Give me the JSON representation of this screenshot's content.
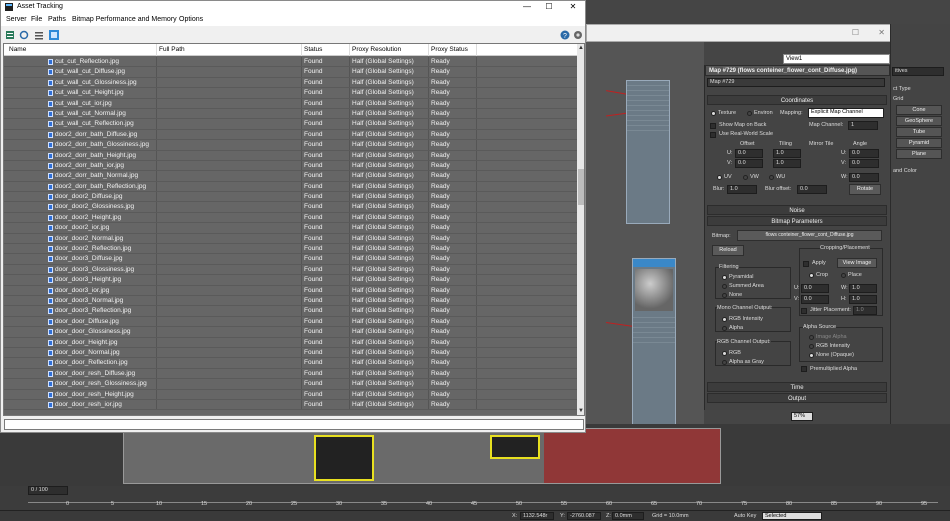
{
  "asset_window": {
    "title": "Asset Tracking",
    "controls": {
      "minimize": "—",
      "maximize": "☐",
      "close": "✕"
    },
    "menu": [
      "Server",
      "File",
      "Paths",
      "Bitmap Performance and Memory",
      "Options"
    ],
    "toolbar_icons": [
      "server-icon",
      "refresh-icon",
      "list-icon",
      "table-view-icon",
      "help-icon",
      "options-icon"
    ],
    "columns": [
      "Name",
      "Full Path",
      "Status",
      "Proxy Resolution",
      "Proxy Status"
    ],
    "rows": [
      {
        "name": "cut_cut_Reflection.jpg",
        "status": "Found",
        "proxy": "Half (Global Settings)",
        "pstat": "Ready"
      },
      {
        "name": "cut_wall_cut_Diffuse.jpg",
        "status": "Found",
        "proxy": "Half (Global Settings)",
        "pstat": "Ready"
      },
      {
        "name": "cut_wall_cut_Glossiness.jpg",
        "status": "Found",
        "proxy": "Half (Global Settings)",
        "pstat": "Ready"
      },
      {
        "name": "cut_wall_cut_Height.jpg",
        "status": "Found",
        "proxy": "Half (Global Settings)",
        "pstat": "Ready"
      },
      {
        "name": "cut_wall_cut_ior.jpg",
        "status": "Found",
        "proxy": "Half (Global Settings)",
        "pstat": "Ready"
      },
      {
        "name": "cut_wall_cut_Normal.jpg",
        "status": "Found",
        "proxy": "Half (Global Settings)",
        "pstat": "Ready"
      },
      {
        "name": "cut_wall_cut_Reflection.jpg",
        "status": "Found",
        "proxy": "Half (Global Settings)",
        "pstat": "Ready"
      },
      {
        "name": "door2_dorr_bath_Diffuse.jpg",
        "status": "Found",
        "proxy": "Half (Global Settings)",
        "pstat": "Ready"
      },
      {
        "name": "door2_dorr_bath_Glossiness.jpg",
        "status": "Found",
        "proxy": "Half (Global Settings)",
        "pstat": "Ready"
      },
      {
        "name": "door2_dorr_bath_Height.jpg",
        "status": "Found",
        "proxy": "Half (Global Settings)",
        "pstat": "Ready"
      },
      {
        "name": "door2_dorr_bath_ior.jpg",
        "status": "Found",
        "proxy": "Half (Global Settings)",
        "pstat": "Ready"
      },
      {
        "name": "door2_dorr_bath_Normal.jpg",
        "status": "Found",
        "proxy": "Half (Global Settings)",
        "pstat": "Ready"
      },
      {
        "name": "door2_dorr_bath_Reflection.jpg",
        "status": "Found",
        "proxy": "Half (Global Settings)",
        "pstat": "Ready"
      },
      {
        "name": "door_door2_Diffuse.jpg",
        "status": "Found",
        "proxy": "Half (Global Settings)",
        "pstat": "Ready"
      },
      {
        "name": "door_door2_Glossiness.jpg",
        "status": "Found",
        "proxy": "Half (Global Settings)",
        "pstat": "Ready"
      },
      {
        "name": "door_door2_Height.jpg",
        "status": "Found",
        "proxy": "Half (Global Settings)",
        "pstat": "Ready"
      },
      {
        "name": "door_door2_ior.jpg",
        "status": "Found",
        "proxy": "Half (Global Settings)",
        "pstat": "Ready"
      },
      {
        "name": "door_door2_Normal.jpg",
        "status": "Found",
        "proxy": "Half (Global Settings)",
        "pstat": "Ready"
      },
      {
        "name": "door_door2_Reflection.jpg",
        "status": "Found",
        "proxy": "Half (Global Settings)",
        "pstat": "Ready"
      },
      {
        "name": "door_door3_Diffuse.jpg",
        "status": "Found",
        "proxy": "Half (Global Settings)",
        "pstat": "Ready"
      },
      {
        "name": "door_door3_Glossiness.jpg",
        "status": "Found",
        "proxy": "Half (Global Settings)",
        "pstat": "Ready"
      },
      {
        "name": "door_door3_Height.jpg",
        "status": "Found",
        "proxy": "Half (Global Settings)",
        "pstat": "Ready"
      },
      {
        "name": "door_door3_ior.jpg",
        "status": "Found",
        "proxy": "Half (Global Settings)",
        "pstat": "Ready"
      },
      {
        "name": "door_door3_Normal.jpg",
        "status": "Found",
        "proxy": "Half (Global Settings)",
        "pstat": "Ready"
      },
      {
        "name": "door_door3_Reflection.jpg",
        "status": "Found",
        "proxy": "Half (Global Settings)",
        "pstat": "Ready"
      },
      {
        "name": "door_door_Diffuse.jpg",
        "status": "Found",
        "proxy": "Half (Global Settings)",
        "pstat": "Ready"
      },
      {
        "name": "door_door_Glossiness.jpg",
        "status": "Found",
        "proxy": "Half (Global Settings)",
        "pstat": "Ready"
      },
      {
        "name": "door_door_Height.jpg",
        "status": "Found",
        "proxy": "Half (Global Settings)",
        "pstat": "Ready"
      },
      {
        "name": "door_door_Normal.jpg",
        "status": "Found",
        "proxy": "Half (Global Settings)",
        "pstat": "Ready"
      },
      {
        "name": "door_door_Reflection.jpg",
        "status": "Found",
        "proxy": "Half (Global Settings)",
        "pstat": "Ready"
      },
      {
        "name": "door_door_resh_Diffuse.jpg",
        "status": "Found",
        "proxy": "Half (Global Settings)",
        "pstat": "Ready"
      },
      {
        "name": "door_door_resh_Glossiness.jpg",
        "status": "Found",
        "proxy": "Half (Global Settings)",
        "pstat": "Ready"
      },
      {
        "name": "door_door_resh_Height.jpg",
        "status": "Found",
        "proxy": "Half (Global Settings)",
        "pstat": "Ready"
      },
      {
        "name": "door_door_resh_ior.jpg",
        "status": "Found",
        "proxy": "Half (Global Settings)",
        "pstat": "Ready"
      }
    ],
    "path_value": ""
  },
  "material_editor": {
    "view_select": "View1",
    "map_title": "Map #729 (flows conteiner_flower_cont_Diffuse.jpg)",
    "map_name": "Map #729",
    "coordinates": {
      "header": "Coordinates",
      "texture": "Texture",
      "environ": "Environ",
      "mapping_label": "Mapping:",
      "mapping_value": "Explicit Map Channel",
      "show_map_on_back": "Show Map on Back",
      "map_channel_label": "Map Channel:",
      "map_channel_value": "1",
      "use_real_world": "Use Real-World Scale",
      "offset": "Offset",
      "tiling": "Tiling",
      "mirror_tile": "Mirror Tile",
      "angle": "Angle",
      "u_label": "U:",
      "v_label": "V:",
      "w_label": "W:",
      "u_offset": "0.0",
      "v_offset": "0.0",
      "u_tiling": "1.0",
      "v_tiling": "1.0",
      "u_angle": "0.0",
      "v_angle": "0.0",
      "w_angle": "0.0",
      "uv": "UV",
      "vw": "VW",
      "wu": "WU",
      "blur_label": "Blur:",
      "blur_value": "1.0",
      "blur_offset_label": "Blur offset:",
      "blur_offset_value": "0.0",
      "rotate": "Rotate"
    },
    "noise_header": "Noise",
    "bitmap_params": {
      "header": "Bitmap Parameters",
      "bitmap_label": "Bitmap:",
      "bitmap_value": "flows conteiner_flower_cont_Diffuse.jpg",
      "reload": "Reload",
      "cropping_label": "Cropping/Placement",
      "apply": "Apply",
      "view_image": "View Image",
      "crop": "Crop",
      "place": "Place",
      "u_val": "0.0",
      "v_val": "0.0",
      "w_val": "1.0",
      "h_val": "1.0",
      "w_label": "W:",
      "h_label": "H:",
      "jitter": "Jitter Placement:",
      "jitter_val": "1.0",
      "filtering": "Filtering",
      "pyramidal": "Pyramidal",
      "summed_area": "Summed Area",
      "none": "None",
      "mono_output": "Mono Channel Output:",
      "rgb_intensity": "RGB Intensity",
      "alpha": "Alpha",
      "rgb_output": "RGB Channel Output:",
      "rgb": "RGB",
      "alpha_as_gray": "Alpha as Gray",
      "alpha_source": "Alpha Source",
      "image_alpha": "Image Alpha",
      "rgb_intensity_2": "RGB Intensity",
      "none_opaque": "None (Opaque)",
      "premultiplied": "Premultiplied Alpha"
    },
    "time_header": "Time",
    "output_header": "Output",
    "zoom": "57%"
  },
  "command_panel": {
    "dropdown": "itives",
    "object_type": "ct Type",
    "autogrid": "Grid",
    "buttons": [
      "Cone",
      "GeoSphere",
      "Tube",
      "Pyramid",
      "Plane"
    ],
    "name_color": "and Color"
  },
  "timeline": {
    "frame": "0 / 100",
    "ticks": [
      "0",
      "5",
      "10",
      "15",
      "20",
      "25",
      "30",
      "35",
      "40",
      "45",
      "50",
      "55",
      "60",
      "65",
      "70",
      "75",
      "80",
      "85",
      "90",
      "95",
      "100"
    ]
  },
  "status_bar": {
    "x": "1132.548r",
    "y": "-2760.087",
    "z": "0.0mm",
    "grid": "Grid = 10.0mm",
    "auto_key": "Auto Key",
    "selected": "Selected"
  },
  "colors": {
    "slate_node_header": "#3a88c8",
    "wire": "#c02020",
    "table_bg": "#666666"
  }
}
